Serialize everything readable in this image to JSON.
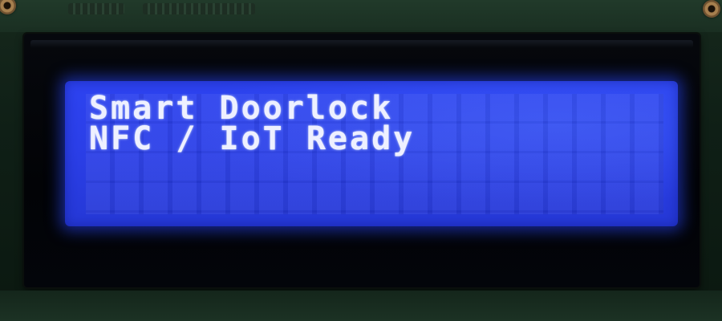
{
  "display": {
    "line1": "Smart Doorlock",
    "line2": "NFC / IoT Ready"
  },
  "colors": {
    "backlight": "#2b3fe8",
    "text": "#eef0ff",
    "bezel": "#03050a",
    "pcb": "#16281c"
  }
}
